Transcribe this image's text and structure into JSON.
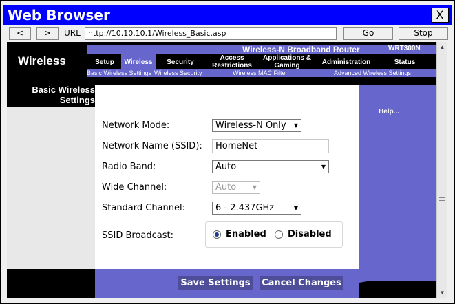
{
  "window": {
    "title": "Web Browser",
    "close_label": "X"
  },
  "navbar": {
    "back_label": "<",
    "forward_label": ">",
    "url_label": "URL",
    "url_value": "http://10.10.10.1/Wireless_Basic.asp",
    "go_label": "Go",
    "stop_label": "Stop"
  },
  "router": {
    "brand": "Wireless-N Broadband Router",
    "model": "WRT300N",
    "section": "Wireless",
    "tabs": [
      {
        "label": "Setup"
      },
      {
        "label": "Wireless"
      },
      {
        "label": "Security"
      },
      {
        "label": "Access Restrictions"
      },
      {
        "label": "Applications & Gaming"
      },
      {
        "label": "Administration"
      },
      {
        "label": "Status"
      }
    ],
    "subtabs": [
      {
        "label": "Basic Wireless Settings"
      },
      {
        "label": "Wireless Security"
      },
      {
        "label": "Wireless MAC Filter"
      },
      {
        "label": "Advanced Wireless Settings"
      }
    ]
  },
  "page": {
    "left_title": "Basic Wireless Settings",
    "help_label": "Help..."
  },
  "form": {
    "network_mode": {
      "label": "Network Mode:",
      "value": "Wireless-N Only"
    },
    "ssid": {
      "label": "Network Name (SSID):",
      "value": "HomeNet"
    },
    "radio_band": {
      "label": "Radio Band:",
      "value": "Auto"
    },
    "wide_channel": {
      "label": "Wide Channel:",
      "value": "Auto"
    },
    "standard_channel": {
      "label": "Standard Channel:",
      "value": "6 - 2.437GHz"
    },
    "ssid_broadcast": {
      "label": "SSID Broadcast:",
      "enabled_label": "Enabled",
      "disabled_label": "Disabled",
      "selected": "Enabled"
    }
  },
  "footer": {
    "save_label": "Save Settings",
    "cancel_label": "Cancel Changes"
  },
  "icons": {
    "dropdown": "chevron-down-icon",
    "scroll_up": "arrow-up-icon",
    "scroll_down": "arrow-down-icon"
  },
  "colors": {
    "title_bar": "#0000ff",
    "accent": "#6666cc",
    "header_black": "#000000",
    "button_dark": "#4d4d9a"
  }
}
